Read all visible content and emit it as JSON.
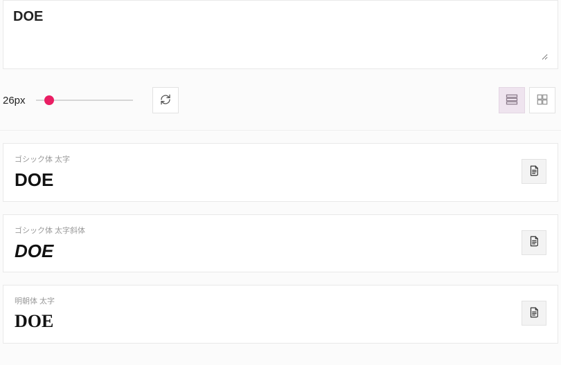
{
  "input": {
    "value": "DOE"
  },
  "controls": {
    "size_label": "26px",
    "slider_value": 26,
    "slider_min": 8,
    "slider_max": 200
  },
  "view_mode": "list",
  "fonts": [
    {
      "label": "ゴシック体 太字",
      "preview": "DOE",
      "style": "sans-bold"
    },
    {
      "label": "ゴシック体 太字斜体",
      "preview": "DOE",
      "style": "sans-bold-italic"
    },
    {
      "label": "明朝体 太字",
      "preview": "DOE",
      "style": "serif-bold"
    }
  ]
}
